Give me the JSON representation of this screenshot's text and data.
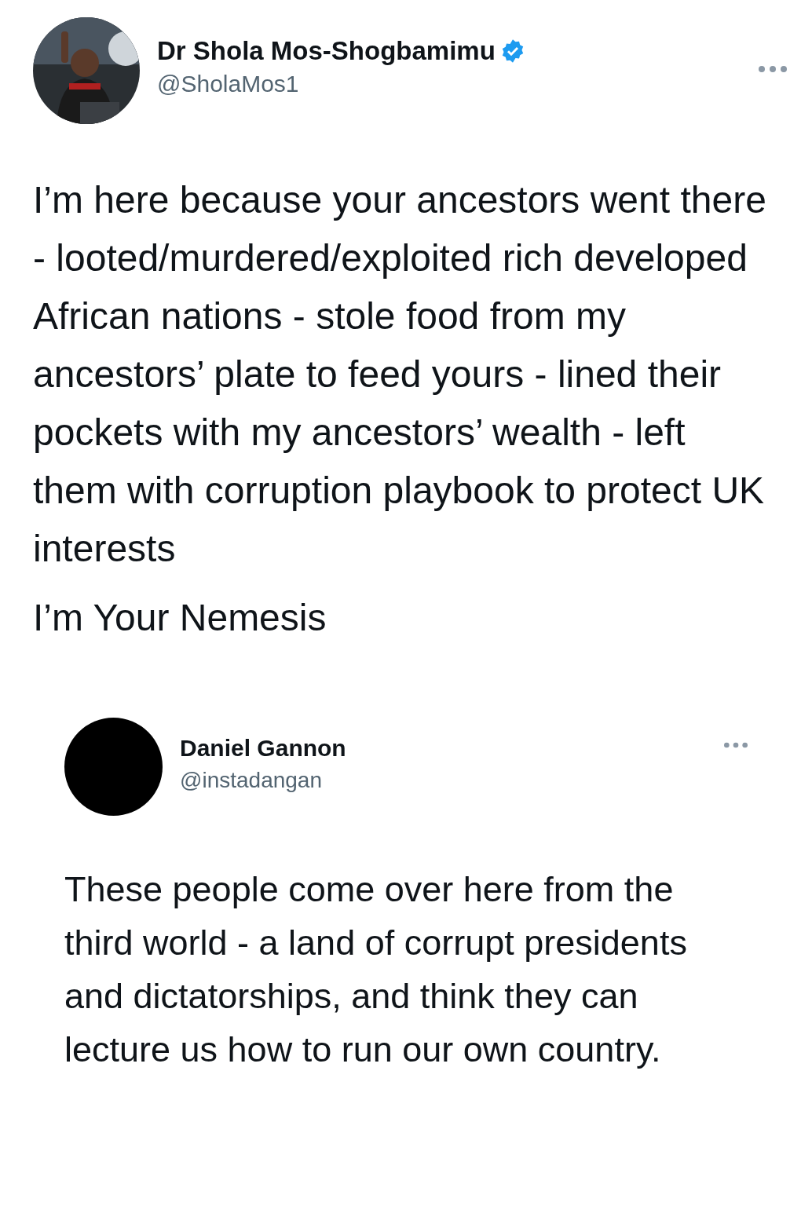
{
  "tweet": {
    "author": {
      "name": "Dr Shola Mos-Shogbamimu",
      "handle": "@SholaMos1",
      "verified": true
    },
    "paragraphs": [
      "I’m here because your ancestors went there - looted/murdered/exploited rich developed African nations - stole food from my ancestors’ plate to feed yours - lined their pockets with my ancestors’ wealth - left them with corruption playbook to protect UK interests",
      "I’m Your Nemesis"
    ]
  },
  "quoted_tweet": {
    "author": {
      "name": "Daniel Gannon",
      "handle": "@instadangan",
      "avatar": {
        "kind": "blank"
      }
    },
    "paragraphs": [
      "These people come over here from the third world - a land of corrupt presidents and dictatorships, and think they can lecture us how to run our own country."
    ]
  }
}
